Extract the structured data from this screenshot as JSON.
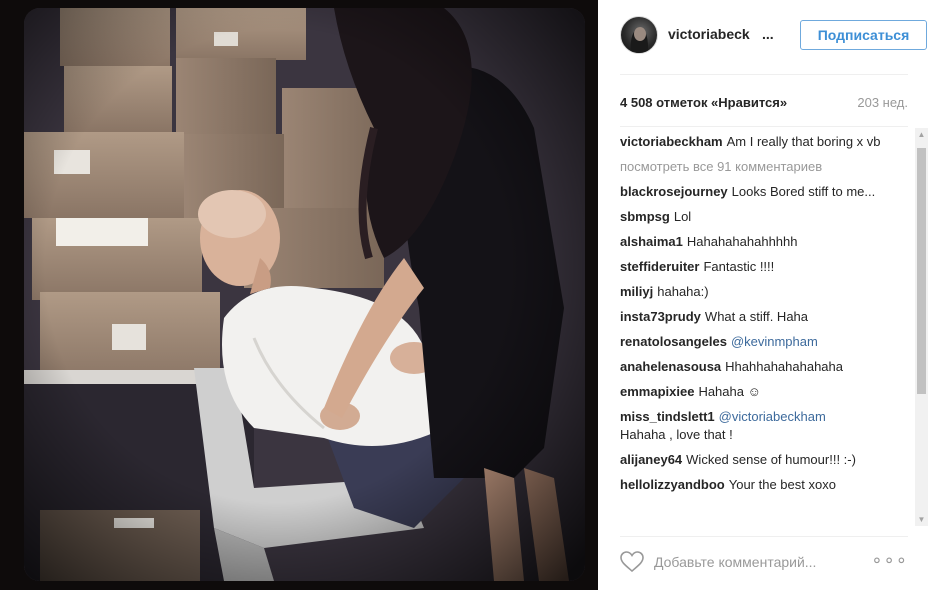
{
  "post": {
    "username": "victoriabeck",
    "username_ellipsis": "...",
    "follow_label": "Подписаться",
    "likes": "4 508 отметок «Нравится»",
    "age": "203 нед.",
    "view_all": "посмотреть все 91 комментариев",
    "comment_placeholder": "Добавьте комментарий...",
    "more_dots": "∘∘∘"
  },
  "comments": [
    {
      "user": "victoriabeckham",
      "text": "Am I really that boring x vb"
    },
    {
      "user": "blackrosejourney",
      "text": "Looks Bored stiff to me..."
    },
    {
      "user": "sbmpsg",
      "text": "Lol"
    },
    {
      "user": "alshaima1",
      "text": "Hahahahahahhhhh"
    },
    {
      "user": "steffideruiter",
      "text": "Fantastic !!!!"
    },
    {
      "user": "miliyj",
      "text": "hahaha:)"
    },
    {
      "user": "insta73prudy",
      "text": "What a stiff. Haha"
    },
    {
      "user": "renatolosangeles",
      "mention": "@kevinmpham"
    },
    {
      "user": "anahelenasousa",
      "text": "Hhahhahahahahaha"
    },
    {
      "user": "emmapixiee",
      "text": "Hahaha ☺"
    },
    {
      "user": "miss_tindslett1",
      "mention": "@victoriabeckham",
      "text": "Hahaha , love that !"
    },
    {
      "user": "alijaney64",
      "text": "Wicked sense of humour!!! :-)"
    },
    {
      "user": "hellolizzyandboo",
      "text": "Your the best xoxo"
    }
  ],
  "icons": {
    "heart": "heart-outline-icon",
    "scroll_up": "▲",
    "scroll_down": "▼"
  },
  "colors": {
    "follow_blue": "#3d8fd6",
    "mention_blue": "#3d6a9c",
    "muted": "#999999"
  }
}
